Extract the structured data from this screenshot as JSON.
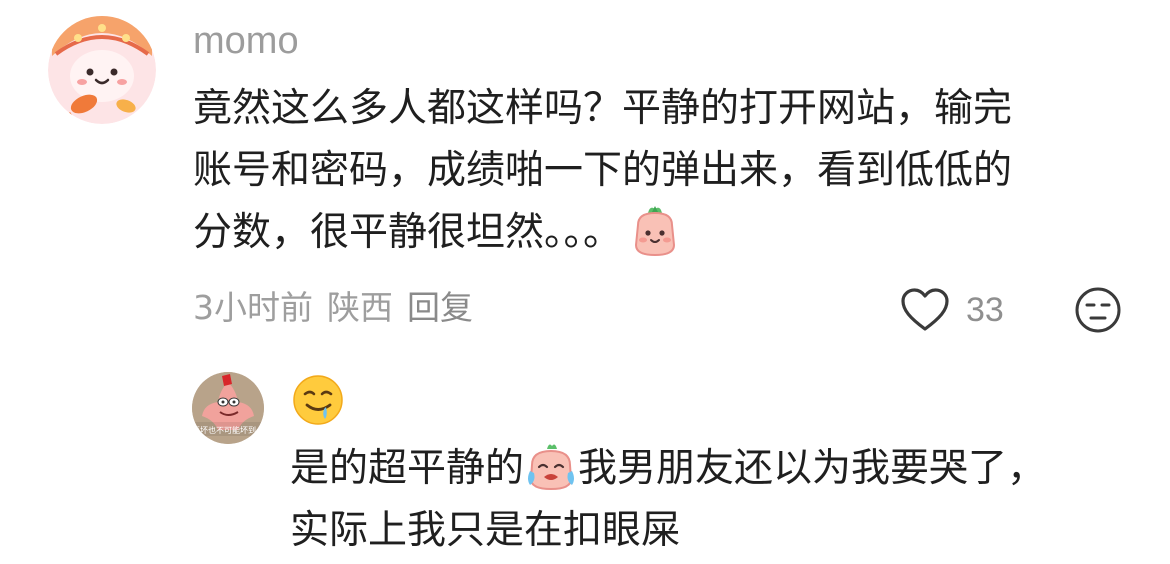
{
  "comment": {
    "username": "momo",
    "text_lines": [
      "竟然这么多人都这样吗？平静的打开网站，输完",
      "账号和密码，成绩啪一下的弹出来，看到低低的",
      "分数，很平静很坦然。。。"
    ],
    "text_sticker": "radish-smile-sticker",
    "time": "3小时前",
    "location": "陕西",
    "reply_label": "回复",
    "like_count": "33",
    "like_icon": "heart-outline-icon",
    "dislike_icon": "unimpressed-face-icon"
  },
  "reply": {
    "avatar_caption": "再坏也不可能坏到…",
    "name_emoji": "drooling-face-emoji",
    "text_line1_before": "是的超平静的",
    "text_line1_after": "我男朋友还以为我要哭了，",
    "text_line2": "实际上我只是在扣眼屎",
    "text_sticker": "radish-crying-sticker"
  },
  "colors": {
    "text_primary": "#1f1f1f",
    "text_secondary": "#9c9c9c",
    "avatar_bg": "#fde2e2",
    "sticker_pink": "#f7b2a8"
  }
}
